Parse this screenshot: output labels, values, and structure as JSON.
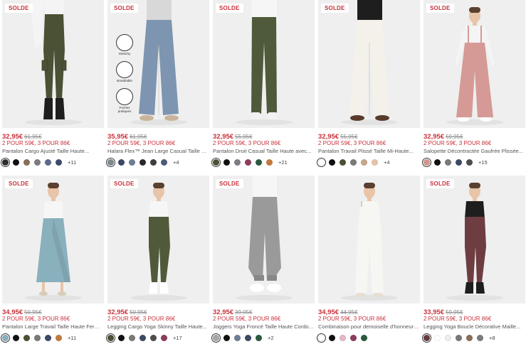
{
  "products": [
    {
      "badge": "SOLDE",
      "price": "32,95€",
      "orig": "61,95€",
      "promo": "2 POUR 59€, 3 POUR 86€",
      "title": "Pantalon Cargo Ajusté Taille Haute...",
      "swatches": [
        "#2e2e2e",
        "#111111",
        "#8a6e55",
        "#7c7c82",
        "#5e6b8a",
        "#3d4b6e"
      ],
      "more": "+11",
      "bg": "#efefef",
      "pant": "#4a5134",
      "top": "#f4f4f4",
      "shoe": "#1e1e1e"
    },
    {
      "badge": "SOLDE",
      "price": "35,95€",
      "orig": "61,95€",
      "promo": "2 POUR 59€, 3 POUR 86€",
      "title": "Halara Flex™ Jean Large Casual Taille Haut...",
      "swatches": [
        "#7f8a8f",
        "#3c4a66",
        "#6e7f95",
        "#2a2a2a",
        "#3e3e3e",
        "#4e5c7a"
      ],
      "more": "+4",
      "bg": "#efefef",
      "pant": "#7d95b0",
      "top": "#d8d8d8",
      "shoe": "#c9b49b",
      "features": [
        "Stretchy",
        "Breathable",
        "Poches pratiques"
      ]
    },
    {
      "badge": "SOLDE",
      "price": "32,95€",
      "orig": "55,95€",
      "promo": "2 POUR 59€, 3 POUR 86€",
      "title": "Pantalon Droit Casual Taille Haute avec...",
      "swatches": [
        "#4a5134",
        "#111111",
        "#7d7f86",
        "#8e3d5e",
        "#2c5a3f",
        "#c47a3e"
      ],
      "more": "+21",
      "bg": "#efefef",
      "pant": "#4f5a3a",
      "top": "#f6f6f6",
      "shoe": "#f2f2f2"
    },
    {
      "badge": "SOLDE",
      "price": "32,95€",
      "orig": "55,95€",
      "promo": "2 POUR 59€, 3 POUR 86€",
      "title": "Pantalon Travail Plissé Taille Mi-Haute...",
      "swatches": [
        "#ffffff",
        "#111111",
        "#4a5134",
        "#7a7a7a",
        "#c7a98a",
        "#e8c4ad"
      ],
      "more": "+4",
      "bg": "#efefef",
      "pant": "#f4f1ea",
      "top": "#1e1e1e",
      "shoe": "#5a3b2a"
    },
    {
      "badge": "SOLDE",
      "price": "32,95€",
      "orig": "59,95€",
      "promo": "2 POUR 59€, 3 POUR 86€",
      "title": "Salopette Décontractée Gaufrée Plissée...",
      "swatches": [
        "#d4958f",
        "#111111",
        "#7a7a7a",
        "#3c4a66",
        "#4e4e4e"
      ],
      "more": "+15",
      "bg": "#efefef",
      "pant": "#d59a95",
      "top": "#f4f4f4",
      "shoe": "#ffffff"
    },
    {
      "badge": "SOLDE",
      "price": "34,95€",
      "orig": "50,95€",
      "promo": "2 POUR 59€, 3 POUR 86€",
      "title": "Pantalon Large Travail Taille Haute Fermetu...",
      "swatches": [
        "#8ab0bf",
        "#111111",
        "#4a5134",
        "#7a7a7a",
        "#3c4a66",
        "#c47a3e"
      ],
      "more": "+11",
      "bg": "#efefef",
      "pant": "#89b0bd",
      "top": "#f6f6f6",
      "shoe": "#d8cbb8"
    },
    {
      "badge": "SOLDE",
      "price": "32,95€",
      "orig": "50,95€",
      "promo": "2 POUR 59€, 3 POUR 86€",
      "title": "Legging Cargo Yoga Skinny Taille Haute...",
      "swatches": [
        "#4a5134",
        "#111111",
        "#7a7a7a",
        "#3c4a66",
        "#4e4e4e",
        "#8e3d5e"
      ],
      "more": "+17",
      "bg": "#efefef",
      "pant": "#505a3a",
      "top": "#f6f6f6",
      "shoe": "#ffffff"
    },
    {
      "badge": "SOLDE",
      "price": "32,95€",
      "orig": "39,95€",
      "promo": "2 POUR 59€, 3 POUR 86€",
      "title": "Joggers Yoga Froncé Taille Haute Cordon d...",
      "swatches": [
        "#a6a6a6",
        "#111111",
        "#6e7f95",
        "#3c4a66",
        "#2c5a3f"
      ],
      "more": "+2",
      "bg": "#efefef",
      "pant": "#9a9a9a",
      "top": "#f6f6f6",
      "shoe": "#ffffff"
    },
    {
      "badge": "",
      "price": "34,95€",
      "orig": "44,95€",
      "promo": "2 POUR 59€, 3 POUR 86€",
      "title": "Combinaison pour demoiselle d'honneur et...",
      "swatches": [
        "#ffffff",
        "#111111",
        "#e7b7c6",
        "#8e3d5e",
        "#2c5a3f"
      ],
      "more": "",
      "bg": "#efefef",
      "pant": "#f6f6f2",
      "top": "#f6f6f2",
      "shoe": "#e8ded0"
    },
    {
      "badge": "SOLDE",
      "price": "33,95€",
      "orig": "59,95€",
      "promo": "2 POUR 59€, 3 POUR 86€",
      "title": "Legging Yoga Boucle Décorative Maille...",
      "swatches": [
        "#6b3a3e",
        "#ffffff",
        "#eeeeee",
        "#7a7a7a",
        "#8a6e55",
        "#7c7c82"
      ],
      "more": "+8",
      "bg": "#efefef",
      "pant": "#6e3d42",
      "top": "#1e1e1e",
      "shoe": "#1e1e1e"
    }
  ]
}
